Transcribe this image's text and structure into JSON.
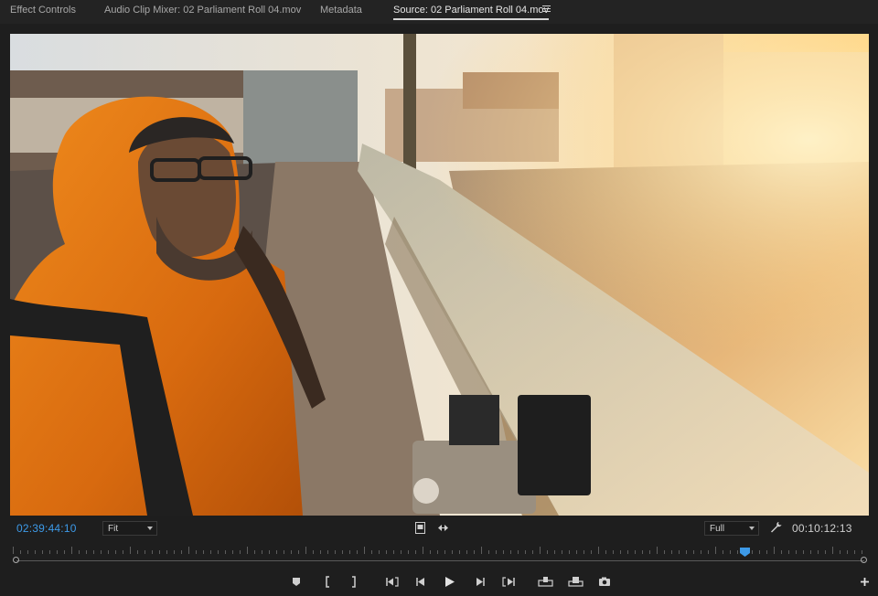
{
  "tabs": [
    {
      "label": "Effect Controls",
      "active": false
    },
    {
      "label": "Audio Clip Mixer: 02 Parliament Roll 04.mov",
      "active": false
    },
    {
      "label": "Metadata",
      "active": false
    },
    {
      "label": "Source: 02 Parliament Roll 04.mov",
      "active": true
    }
  ],
  "panel_menu_icon": "hamburger-icon",
  "controls": {
    "timecode_current": "02:39:44:10",
    "zoom_value": "Fit",
    "resolution_value": "Full",
    "timecode_duration": "00:10:12:13",
    "icons": [
      "drag-video-only-icon",
      "drag-audio-only-icon",
      "wrench-icon"
    ]
  },
  "transport": {
    "icons": [
      "add-marker-icon",
      "mark-in-icon",
      "mark-out-icon",
      "go-to-in-icon",
      "step-back-icon",
      "play-icon",
      "step-forward-icon",
      "go-to-out-icon",
      "insert-icon",
      "overwrite-icon",
      "export-frame-icon",
      "add-button-icon"
    ]
  },
  "timeline": {
    "playhead_position_fraction": 0.857
  },
  "colors": {
    "accent_blue": "#3d9ae8",
    "background": "#1e1e1e",
    "tab_bar": "#232323"
  }
}
